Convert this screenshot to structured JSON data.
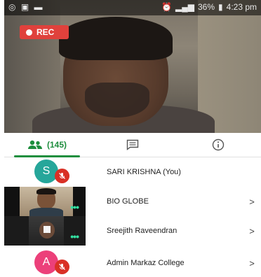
{
  "status_bar": {
    "left_icons": [
      "whatsapp-icon",
      "image-icon",
      "message-icon"
    ],
    "battery": "36%",
    "time": "4:23 pm"
  },
  "recording": {
    "label": "REC",
    "color": "#e0413c"
  },
  "tabs": [
    {
      "label": "(145)",
      "icon": "people-icon",
      "active": true
    },
    {
      "label": "",
      "icon": "chat-icon",
      "active": false
    },
    {
      "label": "",
      "icon": "info-icon",
      "active": false
    }
  ],
  "participants": [
    {
      "name": "SARI KRISHNA (You)",
      "avatar_letter": "S",
      "avatar_color": "#26a69a",
      "muted": true,
      "video": false
    },
    {
      "name": "BIO GLOBE",
      "video": true,
      "chevron": ">"
    },
    {
      "name": "Sreejith Raveendran",
      "video": true,
      "chevron": ">"
    },
    {
      "name": "Admin Markaz College",
      "avatar_letter": "A",
      "avatar_color": "#ec407a",
      "muted": true,
      "video": false,
      "chevron": ">"
    }
  ],
  "colors": {
    "accent": "#1e8e3e",
    "mute": "#d93025",
    "speaking": "#34e0a1"
  }
}
